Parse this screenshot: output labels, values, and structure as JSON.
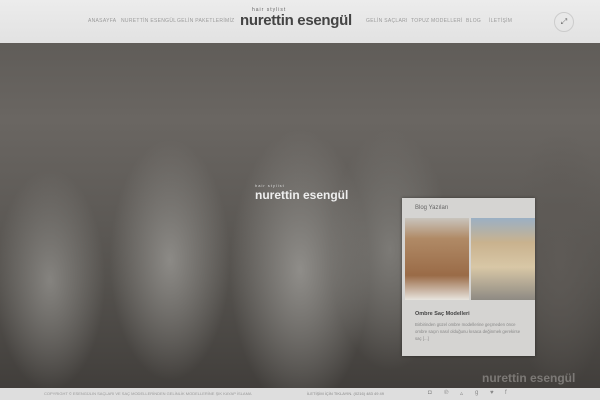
{
  "nav": {
    "left": [
      "ANASAYFA",
      "NURETTİN ESENGÜL",
      "GELİN PAKETLERİMİZ"
    ],
    "right": [
      "GELİN SAÇLARI",
      "TOPUZ MODELLERİ",
      "BLOG",
      "İLETİŞİM"
    ]
  },
  "logo": {
    "tagline": "hair stylist",
    "name": "nurettin esengül"
  },
  "blog": {
    "title": "Blog Yazıları",
    "post_title": "Ombre Saç Modelleri",
    "post_excerpt": "Birbirinden güzel ombre modellerine geçmeden önce ombre saçın nasıl olduğunu kısaca değinmek gerekirse saç [...]"
  },
  "footer": {
    "copyright": "COPYRIGHT © ESENGÜLIN SAÇLARI VE SAÇ MODELLERİNDEN GELİNLİK MODELLERİNE ŞIK KAYAP İSLAMA",
    "contact": "İLETİŞİM İÇİN TIKLAYIN. (0216) 483 49 49",
    "social": [
      "instagram-icon",
      "pinterest-icon",
      "foursquare-icon",
      "google-plus-icon",
      "twitter-icon",
      "facebook-icon"
    ]
  }
}
